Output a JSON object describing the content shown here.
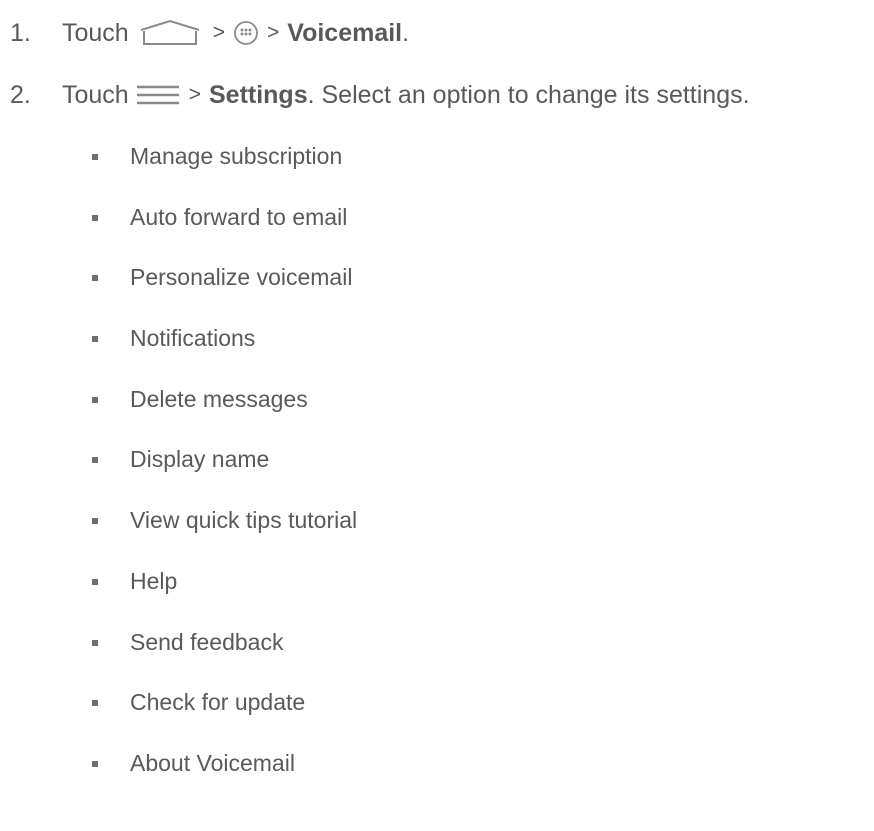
{
  "steps": [
    {
      "number": "1.",
      "verb": "Touch",
      "separator_1": ">",
      "separator_2": ">",
      "target": "Voicemail",
      "end": "."
    },
    {
      "number": "2.",
      "verb": "Touch",
      "separator_1": ">",
      "target": "Settings",
      "rest": ". Select an option to change its settings."
    }
  ],
  "icons": {
    "home": "home-icon",
    "apps": "apps-icon",
    "menu": "menu-icon",
    "color": "#8a8a8a"
  },
  "options": [
    "Manage subscription",
    "Auto forward to email",
    "Personalize voicemail",
    "Notifications",
    "Delete messages",
    "Display name",
    "View quick tips tutorial",
    "Help",
    "Send feedback",
    "Check for update",
    "About Voicemail"
  ],
  "colors": {
    "text": "#595959",
    "bullet": "#6e6e6e"
  }
}
